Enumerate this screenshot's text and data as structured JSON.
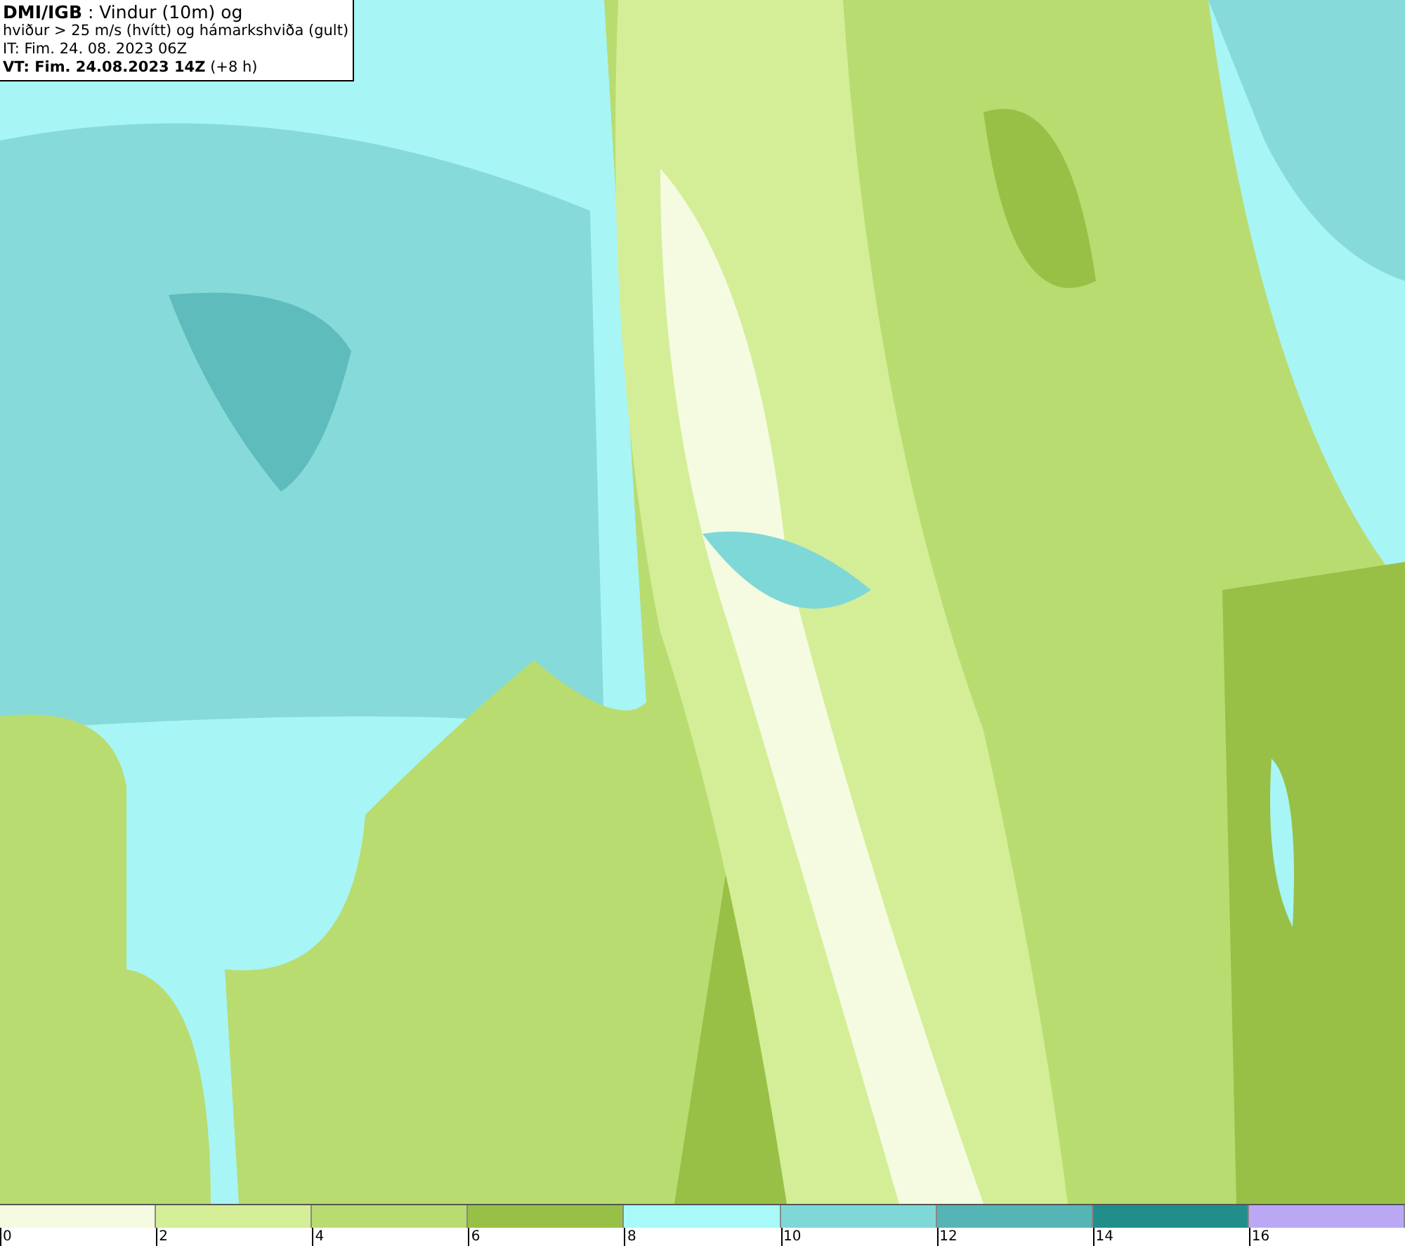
{
  "header": {
    "lines": [
      "**DMI/IGB** : Vindur (10m) og",
      "hviður > 25 m/s (hvítt) og hámarkshviða (gult)",
      "IT: Fim. 24. 08. 2023 06Z",
      "**VT: Fim. 24.08.2023 14Z** (+8 h)"
    ]
  },
  "legend": {
    "bins": [
      {
        "color": "#f5fbe1",
        "tick": "0"
      },
      {
        "color": "#d4ee97",
        "tick": "2"
      },
      {
        "color": "#b8dc70",
        "tick": "4"
      },
      {
        "color": "#98c046",
        "tick": "6"
      },
      {
        "color": "#a8fafa",
        "tick": "8"
      },
      {
        "color": "#7fd8d8",
        "tick": "10"
      },
      {
        "color": "#55b5b5",
        "tick": "12"
      },
      {
        "color": "#228e8c",
        "tick": "14"
      },
      {
        "color": "#bba8f5",
        "tick": "16"
      }
    ]
  }
}
